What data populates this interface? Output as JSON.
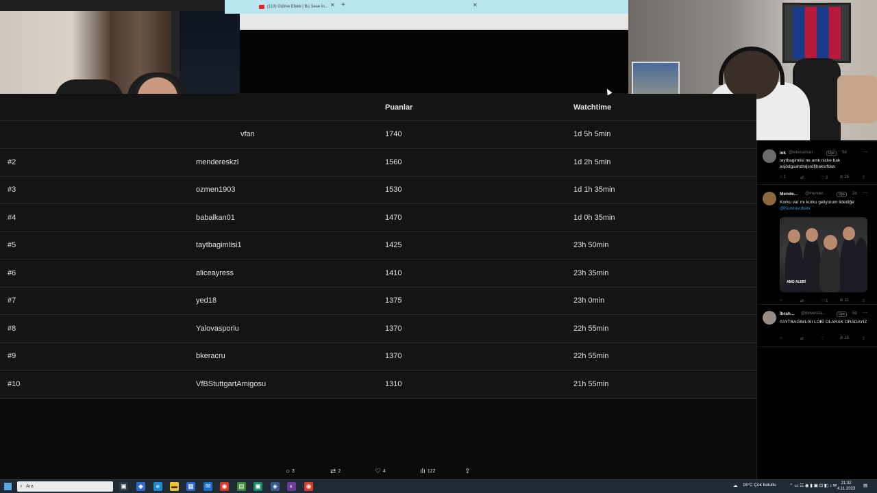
{
  "browser": {
    "tab_title": "(119) Gülme Efekti | Bu Sese İn...",
    "tab_close": "✕",
    "new_tab": "+"
  },
  "leaderboard": {
    "columns": [
      "Puanlar",
      "Watchtime"
    ],
    "partial_row": {
      "username": "vfan",
      "points": "1740",
      "watchtime": "1d 5h 5min"
    },
    "rows": [
      {
        "rank": "#2",
        "username": "mendereskzl",
        "points": "1560",
        "watchtime": "1d 2h 5min"
      },
      {
        "rank": "#3",
        "username": "ozmen1903",
        "points": "1530",
        "watchtime": "1d 1h 35min"
      },
      {
        "rank": "#4",
        "username": "babalkan01",
        "points": "1470",
        "watchtime": "1d 0h 35min"
      },
      {
        "rank": "#5",
        "username": "taytbagimlisi1",
        "points": "1425",
        "watchtime": "23h 50min"
      },
      {
        "rank": "#6",
        "username": "aliceayress",
        "points": "1410",
        "watchtime": "23h 35min"
      },
      {
        "rank": "#7",
        "username": "yed18",
        "points": "1375",
        "watchtime": "23h 0min"
      },
      {
        "rank": "#8",
        "username": "Yalovasporlu",
        "points": "1370",
        "watchtime": "22h 55min"
      },
      {
        "rank": "#9",
        "username": "bkeracru",
        "points": "1370",
        "watchtime": "22h 55min"
      },
      {
        "rank": "#10",
        "username": "VfBStuttgartAmigosu",
        "points": "1310",
        "watchtime": "21h 55min"
      }
    ]
  },
  "twitter": {
    "tweets": [
      {
        "name": "iek",
        "handle": "@iekocaman",
        "badge": "Üye",
        "time": "5d",
        "text": "taytbagimlisi ne amk nicke bak asjödgsahdrajsrdfjhaksrfdas",
        "mention": "",
        "replies": "1",
        "retweets": "",
        "likes": "2",
        "views": "26"
      },
      {
        "name": "Mende...",
        "handle": "@mender...",
        "badge": "Üye",
        "time": "2d",
        "text": "Korku var mı korku geliyorum liderliğe ",
        "mention": "@Kontravoltatv",
        "image_caption": "AMO ALEBİ",
        "replies": "",
        "retweets": "",
        "likes": "1",
        "views": "11"
      },
      {
        "name": "İbrah...",
        "handle": "@iboversta...",
        "badge": "Üye",
        "time": "5d",
        "text": "TAYTBAGIMLISI LOBİ OLARAK ORADAYIZ",
        "mention": "",
        "replies": "",
        "retweets": "",
        "likes": "",
        "views": "15"
      }
    ]
  },
  "stream_actions": {
    "replies": "3",
    "retweets": "2",
    "likes": "4",
    "views": "122"
  },
  "taskbar": {
    "search_placeholder": "Ara",
    "weather": "16°C  Çok bulutlu",
    "time": "21:32",
    "date": "4.11.2023"
  }
}
